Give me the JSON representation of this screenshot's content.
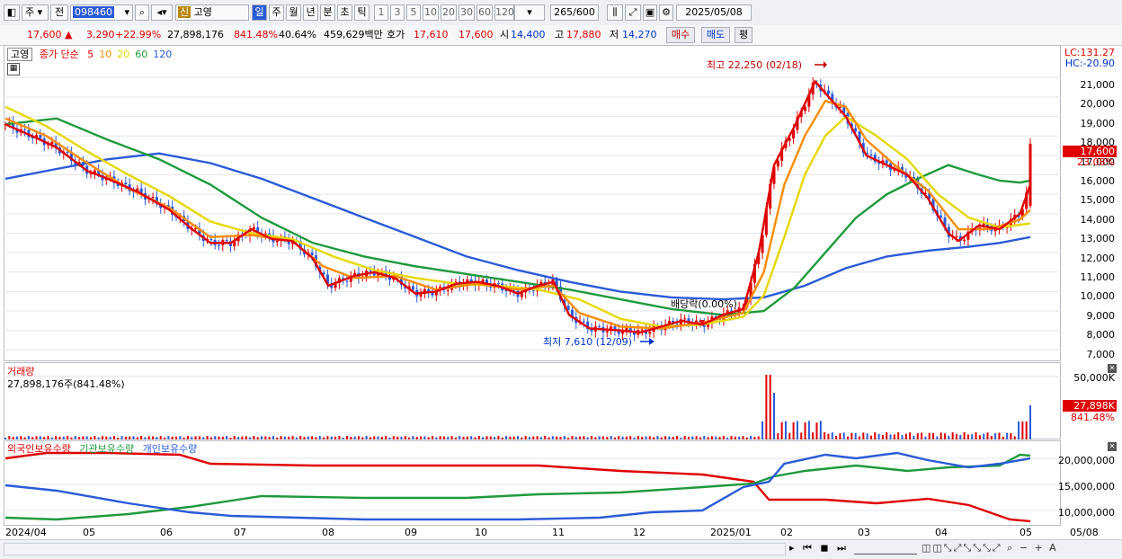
{
  "toolbar": {
    "period_type": "주",
    "prev_label": "전",
    "stock_code": "098460",
    "new_badge": "신",
    "stock_name": "고영",
    "period_buttons": [
      "일",
      "주",
      "월",
      "년",
      "분",
      "초",
      "틱"
    ],
    "interval_buttons": [
      "1",
      "3",
      "5",
      "10",
      "20",
      "30",
      "60",
      "120"
    ],
    "count_display": "265",
    "count_total": "/600",
    "date": "2025/05/08"
  },
  "quote": {
    "price": "17,600",
    "change": "3,290",
    "change_pct": "+22.99%",
    "volume": "27,898,176",
    "volume_pct": "841.48%",
    "turnover": "40.64%",
    "amount": "459,629백만",
    "ask_label": "호가",
    "ask": "17,610",
    "bid": "17,600",
    "open_label": "시",
    "open": "14,400",
    "high_label": "고",
    "high": "17,880",
    "low_label": "저",
    "low": "14,270",
    "buy_label": "매수",
    "sell_label": "매도",
    "eval_label": "평"
  },
  "price_panel": {
    "name_tag": "고영",
    "legend_title": "종가 단순",
    "ma_periods": [
      "5",
      "10",
      "20",
      "60",
      "120"
    ],
    "ma_colors": [
      "#e00000",
      "#ff8c00",
      "#e6d800",
      "#1e9a3c",
      "#2a5bd7"
    ],
    "lc_label": "LC:131.27",
    "hc_label": "HC:-20.90",
    "y_ticks": [
      "21,000",
      "20,000",
      "19,000",
      "18,000",
      "17,000",
      "16,000",
      "15,000",
      "14,000",
      "13,000",
      "12,000",
      "11,000",
      "10,000",
      "9,000",
      "8,000",
      "7,000"
    ],
    "current_price_tag": "17,600",
    "current_pct_tag": "23.08%",
    "annotations": {
      "high": "최고 22,250 (02/18)",
      "low": "최저 7,610 (12/09)",
      "dividend": "배당락(0.00%)"
    }
  },
  "volume_panel": {
    "title": "거래량",
    "value": "27,898,176주(841.48%)",
    "y_tick": "50,000K",
    "current_tag": "27,898K",
    "current_pct": "841.48%"
  },
  "holdings_panel": {
    "legend": [
      "외국인보유수량",
      "기관보유수량",
      "개인보유수량"
    ],
    "colors": [
      "#e00000",
      "#1e9a3c",
      "#2a5bd7"
    ],
    "y_ticks": [
      "20,000,000",
      "15,000,000",
      "10,000,000"
    ]
  },
  "x_axis": {
    "labels": [
      "2024/04",
      "05",
      "06",
      "07",
      "08",
      "09",
      "10",
      "11",
      "12",
      "2025/01",
      "02",
      "03",
      "04",
      "05"
    ],
    "right_label": "05/08"
  },
  "chart_data": {
    "type": "line",
    "title": "고영",
    "y_range": [
      6600,
      22400
    ],
    "series": [
      {
        "name": "5",
        "color": "#e00000",
        "points": [
          [
            0,
            18600
          ],
          [
            0.03,
            17900
          ],
          [
            0.05,
            17400
          ],
          [
            0.08,
            16200
          ],
          [
            0.1,
            15800
          ],
          [
            0.13,
            15100
          ],
          [
            0.16,
            14200
          ],
          [
            0.18,
            13300
          ],
          [
            0.2,
            12500
          ],
          [
            0.22,
            12500
          ],
          [
            0.24,
            13200
          ],
          [
            0.26,
            12700
          ],
          [
            0.28,
            12600
          ],
          [
            0.3,
            11700
          ],
          [
            0.315,
            10300
          ],
          [
            0.34,
            10800
          ],
          [
            0.36,
            11000
          ],
          [
            0.38,
            10700
          ],
          [
            0.4,
            9900
          ],
          [
            0.42,
            10000
          ],
          [
            0.44,
            10400
          ],
          [
            0.46,
            10500
          ],
          [
            0.48,
            10300
          ],
          [
            0.5,
            9900
          ],
          [
            0.52,
            10300
          ],
          [
            0.535,
            10500
          ],
          [
            0.55,
            8800
          ],
          [
            0.57,
            8100
          ],
          [
            0.6,
            8000
          ],
          [
            0.62,
            7900
          ],
          [
            0.64,
            8200
          ],
          [
            0.66,
            8500
          ],
          [
            0.68,
            8300
          ],
          [
            0.7,
            8800
          ],
          [
            0.72,
            9100
          ],
          [
            0.735,
            12000
          ],
          [
            0.75,
            16500
          ],
          [
            0.77,
            18500
          ],
          [
            0.79,
            20800
          ],
          [
            0.8,
            20200
          ],
          [
            0.82,
            19000
          ],
          [
            0.84,
            17000
          ],
          [
            0.86,
            16500
          ],
          [
            0.88,
            16000
          ],
          [
            0.9,
            14800
          ],
          [
            0.92,
            13000
          ],
          [
            0.93,
            12600
          ],
          [
            0.95,
            13400
          ],
          [
            0.97,
            13200
          ],
          [
            0.99,
            14000
          ],
          [
            1.0,
            15500
          ]
        ]
      },
      {
        "name": "10",
        "color": "#ff8c00",
        "points": [
          [
            0,
            18900
          ],
          [
            0.04,
            18000
          ],
          [
            0.08,
            16600
          ],
          [
            0.12,
            15300
          ],
          [
            0.16,
            14300
          ],
          [
            0.2,
            12800
          ],
          [
            0.24,
            12900
          ],
          [
            0.28,
            12600
          ],
          [
            0.31,
            11300
          ],
          [
            0.34,
            10700
          ],
          [
            0.38,
            10800
          ],
          [
            0.42,
            10100
          ],
          [
            0.46,
            10400
          ],
          [
            0.5,
            10100
          ],
          [
            0.535,
            10300
          ],
          [
            0.56,
            8900
          ],
          [
            0.6,
            8200
          ],
          [
            0.64,
            8100
          ],
          [
            0.68,
            8400
          ],
          [
            0.72,
            8900
          ],
          [
            0.74,
            11000
          ],
          [
            0.76,
            15500
          ],
          [
            0.78,
            18000
          ],
          [
            0.8,
            19800
          ],
          [
            0.82,
            19500
          ],
          [
            0.84,
            17800
          ],
          [
            0.87,
            16400
          ],
          [
            0.9,
            15200
          ],
          [
            0.93,
            13200
          ],
          [
            0.96,
            13200
          ],
          [
            0.99,
            13700
          ],
          [
            1.0,
            14200
          ]
        ]
      },
      {
        "name": "20",
        "color": "#e6d800",
        "points": [
          [
            0,
            19500
          ],
          [
            0.04,
            18500
          ],
          [
            0.08,
            17200
          ],
          [
            0.12,
            16000
          ],
          [
            0.16,
            14900
          ],
          [
            0.2,
            13600
          ],
          [
            0.24,
            13000
          ],
          [
            0.28,
            12700
          ],
          [
            0.32,
            11800
          ],
          [
            0.36,
            11100
          ],
          [
            0.4,
            10700
          ],
          [
            0.44,
            10400
          ],
          [
            0.48,
            10300
          ],
          [
            0.52,
            10100
          ],
          [
            0.56,
            9600
          ],
          [
            0.6,
            8600
          ],
          [
            0.64,
            8200
          ],
          [
            0.68,
            8300
          ],
          [
            0.72,
            8700
          ],
          [
            0.74,
            9800
          ],
          [
            0.76,
            12800
          ],
          [
            0.78,
            16000
          ],
          [
            0.8,
            18000
          ],
          [
            0.82,
            19000
          ],
          [
            0.85,
            18000
          ],
          [
            0.88,
            16800
          ],
          [
            0.91,
            15000
          ],
          [
            0.94,
            13800
          ],
          [
            0.97,
            13300
          ],
          [
            1.0,
            13500
          ]
        ]
      },
      {
        "name": "60",
        "color": "#1e9a3c",
        "points": [
          [
            0,
            18600
          ],
          [
            0.05,
            18900
          ],
          [
            0.1,
            17800
          ],
          [
            0.15,
            16800
          ],
          [
            0.2,
            15500
          ],
          [
            0.25,
            13800
          ],
          [
            0.3,
            12500
          ],
          [
            0.35,
            11800
          ],
          [
            0.4,
            11300
          ],
          [
            0.45,
            10900
          ],
          [
            0.5,
            10500
          ],
          [
            0.55,
            10100
          ],
          [
            0.6,
            9600
          ],
          [
            0.65,
            9100
          ],
          [
            0.7,
            8800
          ],
          [
            0.74,
            9000
          ],
          [
            0.77,
            10200
          ],
          [
            0.8,
            12000
          ],
          [
            0.83,
            13800
          ],
          [
            0.86,
            15000
          ],
          [
            0.89,
            15800
          ],
          [
            0.92,
            16500
          ],
          [
            0.95,
            16000
          ],
          [
            0.97,
            15700
          ],
          [
            0.99,
            15600
          ],
          [
            1.0,
            15700
          ]
        ]
      },
      {
        "name": "120",
        "color": "#2a5bd7",
        "points": [
          [
            0,
            15800
          ],
          [
            0.05,
            16300
          ],
          [
            0.1,
            16800
          ],
          [
            0.15,
            17100
          ],
          [
            0.2,
            16600
          ],
          [
            0.25,
            15800
          ],
          [
            0.3,
            14800
          ],
          [
            0.35,
            13800
          ],
          [
            0.4,
            12800
          ],
          [
            0.45,
            11800
          ],
          [
            0.5,
            11100
          ],
          [
            0.55,
            10500
          ],
          [
            0.6,
            10000
          ],
          [
            0.65,
            9700
          ],
          [
            0.7,
            9600
          ],
          [
            0.74,
            9700
          ],
          [
            0.78,
            10300
          ],
          [
            0.82,
            11200
          ],
          [
            0.86,
            11800
          ],
          [
            0.9,
            12100
          ],
          [
            0.94,
            12300
          ],
          [
            0.97,
            12500
          ],
          [
            1.0,
            12800
          ]
        ]
      }
    ]
  }
}
